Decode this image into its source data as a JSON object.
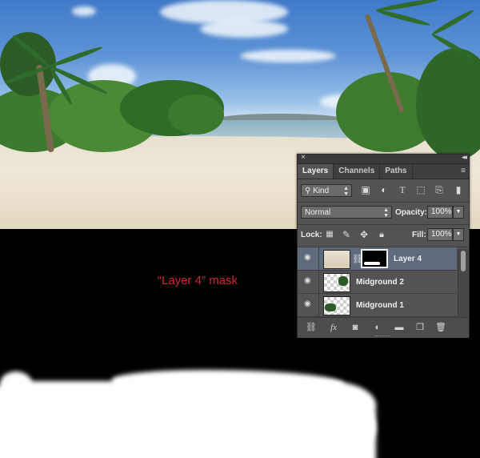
{
  "mask_caption": "“Layer 4” mask",
  "panel": {
    "tabs": [
      {
        "label": "Layers",
        "active": true
      },
      {
        "label": "Channels",
        "active": false
      },
      {
        "label": "Paths",
        "active": false
      }
    ],
    "filter": {
      "label": "Kind",
      "icons": [
        "image-filter-icon",
        "adjustment-filter-icon",
        "type-filter-icon",
        "shape-filter-icon",
        "smart-object-filter-icon",
        "filter-toggle-icon"
      ]
    },
    "blend_mode": "Normal",
    "opacity_label": "Opacity:",
    "opacity_value": "100%",
    "lock_label": "Lock:",
    "fill_label": "Fill:",
    "fill_value": "100%",
    "layers": [
      {
        "name": "Layer 4",
        "selected": true,
        "has_mask": true
      },
      {
        "name": "Midground 2",
        "selected": false,
        "has_mask": false
      },
      {
        "name": "Midground 1",
        "selected": false,
        "has_mask": false
      }
    ],
    "bottom_icons": [
      "link-layers-icon",
      "fx-icon",
      "add-mask-icon",
      "adjustment-layer-icon",
      "new-group-icon",
      "new-layer-icon",
      "trash-icon"
    ],
    "fx_label": "fx",
    "close_glyph": "×",
    "collapse_glyph": "◂◂",
    "menu_glyph": "≡"
  }
}
